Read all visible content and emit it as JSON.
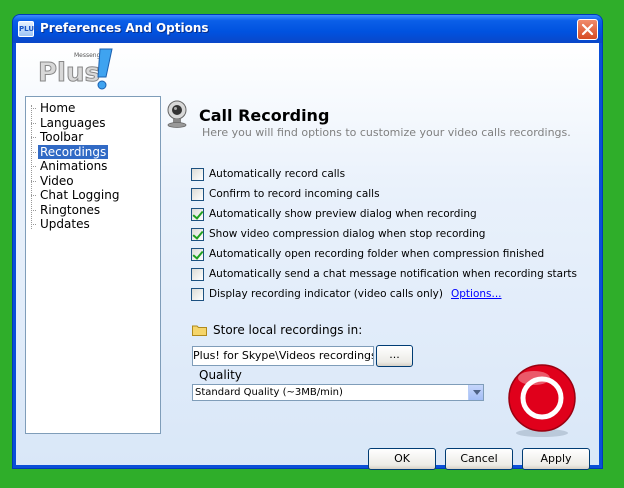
{
  "window": {
    "title": "Preferences And Options",
    "icon_text": "PLUS"
  },
  "logo": {
    "text": "Plus",
    "small_text": "Messenger"
  },
  "sidebar": {
    "items": [
      {
        "label": "Home",
        "selected": false
      },
      {
        "label": "Languages",
        "selected": false
      },
      {
        "label": "Toolbar",
        "selected": false
      },
      {
        "label": "Recordings",
        "selected": true
      },
      {
        "label": "Animations",
        "selected": false
      },
      {
        "label": "Video",
        "selected": false
      },
      {
        "label": "Chat Logging",
        "selected": false
      },
      {
        "label": "Ringtones",
        "selected": false
      },
      {
        "label": "Updates",
        "selected": false
      }
    ]
  },
  "main": {
    "heading": "Call Recording",
    "subheading": "Here you will find options to customize your video calls recordings.",
    "options": [
      {
        "label": "Automatically record calls",
        "checked": false
      },
      {
        "label": "Confirm to record incoming calls",
        "checked": false
      },
      {
        "label": "Automatically show preview dialog when recording",
        "checked": true
      },
      {
        "label": "Show video compression dialog when stop recording",
        "checked": true
      },
      {
        "label": "Automatically open recording folder when compression finished",
        "checked": true
      },
      {
        "label": "Automatically send a chat message notification when recording starts",
        "checked": false
      },
      {
        "label": "Display recording indicator (video calls only)",
        "checked": false
      }
    ],
    "options_link": "Options...",
    "folder_label": "Store local recordings in:",
    "folder_path": "Plus! for Skype\\Videos recordings",
    "browse_label": "...",
    "quality_label": "Quality",
    "quality_value": "Standard Quality (~3MB/min)"
  },
  "buttons": {
    "ok": "OK",
    "cancel": "Cancel",
    "apply": "Apply"
  },
  "colors": {
    "background": "#2fae2a",
    "titlebar": "#0052df",
    "selection": "#316ac5",
    "close": "#d64b22",
    "record": "#e0001b"
  },
  "icons": [
    "close-icon",
    "webcam-icon",
    "folder-icon",
    "record-icon",
    "dropdown-arrow-icon",
    "checkmark-icon"
  ]
}
